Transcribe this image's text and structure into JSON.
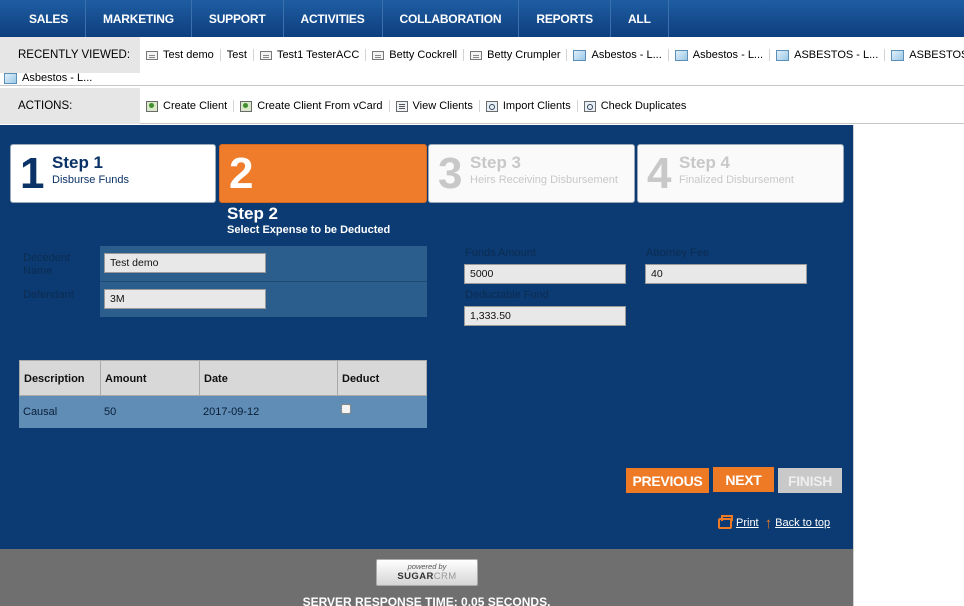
{
  "nav": {
    "items": [
      "SALES",
      "MARKETING",
      "SUPPORT",
      "ACTIVITIES",
      "COLLABORATION",
      "REPORTS",
      "ALL"
    ]
  },
  "recently_viewed": {
    "label": "RECENTLY VIEWED:",
    "items": [
      {
        "label": "Test demo",
        "icon": "contact-card-icon"
      },
      {
        "label": "Test",
        "icon": "none"
      },
      {
        "label": "Test1 TesterACC",
        "icon": "contact-card-icon"
      },
      {
        "label": "Betty Cockrell",
        "icon": "contact-card-icon"
      },
      {
        "label": "Betty Crumpler",
        "icon": "contact-card-icon"
      },
      {
        "label": "Asbestos - L...",
        "icon": "window-icon"
      },
      {
        "label": "Asbestos - L...",
        "icon": "window-icon"
      },
      {
        "label": "ASBESTOS - L...",
        "icon": "window-icon"
      },
      {
        "label": "ASBESTOS - L...",
        "icon": "window-icon"
      },
      {
        "label": "Asbestos - L...",
        "icon": "window-icon"
      }
    ]
  },
  "actions": {
    "label": "ACTIONS:",
    "items": [
      {
        "label": "Create Client",
        "icon": "create-client-icon"
      },
      {
        "label": "Create Client From vCard",
        "icon": "vcard-icon"
      },
      {
        "label": "View Clients",
        "icon": "list-icon"
      },
      {
        "label": "Import Clients",
        "icon": "import-icon"
      },
      {
        "label": "Check Duplicates",
        "icon": "check-duplicates-icon"
      }
    ]
  },
  "wizard": {
    "steps": [
      {
        "num": "1",
        "title": "Step 1",
        "sub": "Disburse Funds"
      },
      {
        "num": "2",
        "title": "",
        "sub": ""
      },
      {
        "num": "3",
        "title": "Step 3",
        "sub": "Heirs Receiving Disbursement"
      },
      {
        "num": "4",
        "title": "Step 4",
        "sub": "Finalized Disbursement"
      }
    ],
    "current_title": "Step 2",
    "current_sub": "Select Expense to be Deducted"
  },
  "form": {
    "decedent_label": "Decedent Name",
    "decedent_value": "Test demo",
    "defendant_label": "Defendant",
    "defendant_value": "3M",
    "funds_label": "Funds Amount",
    "funds_value": "5000",
    "attorney_label": "Attorney Fee",
    "attorney_value": "40",
    "deductable_label": "Deductable Fund",
    "deductable_value": "1,333.50"
  },
  "expense_table": {
    "headers": [
      "Description",
      "Amount",
      "Date",
      "Deduct"
    ],
    "rows": [
      {
        "description": "Causal",
        "amount": "50",
        "date": "2017-09-12",
        "deduct": false
      }
    ]
  },
  "buttons": {
    "previous": "PREVIOUS",
    "next": "NEXT",
    "finish": "FINISH"
  },
  "links": {
    "print": "Print",
    "back_to_top": "Back to top"
  },
  "footer": {
    "powered_by": "powered by",
    "logo_strong": "SUGAR",
    "logo_light": "CRM",
    "server_response": "SERVER RESPONSE TIME: 0.05 SECONDS."
  },
  "colors": {
    "nav_blue": "#0d3f7e",
    "panel_blue": "#0b3b72",
    "accent_orange": "#ee7a25"
  }
}
